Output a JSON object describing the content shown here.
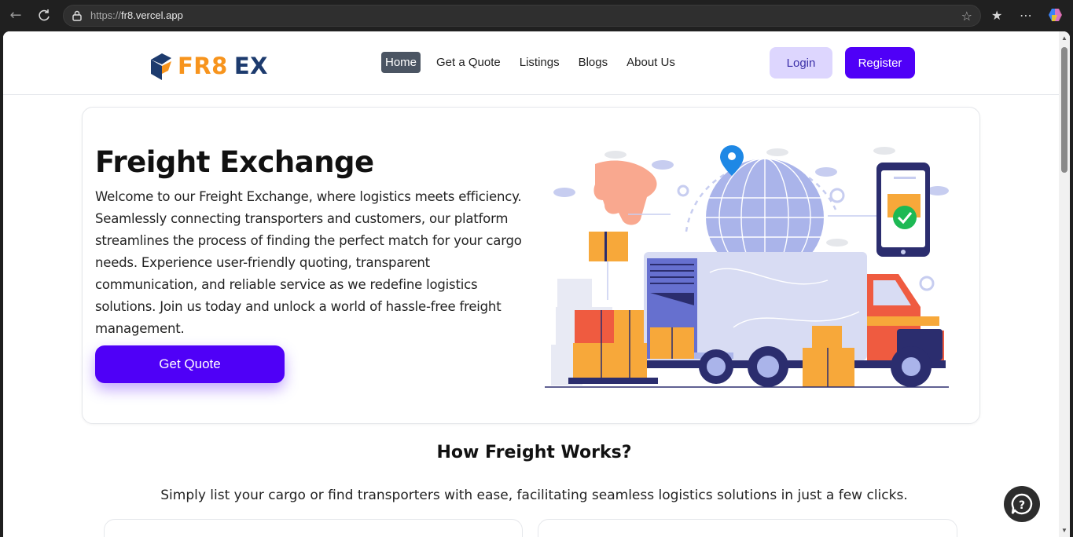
{
  "browser": {
    "url_protocol": "https://",
    "url_host": "fr8.vercel.app"
  },
  "header": {
    "logo_part1": "FR8",
    "logo_part2": "EX",
    "nav": [
      "Home",
      "Get a Quote",
      "Listings",
      "Blogs",
      "About Us"
    ],
    "active_nav": "Home",
    "login_label": "Login",
    "register_label": "Register"
  },
  "hero": {
    "title": "Freight Exchange",
    "body": "Welcome to our Freight Exchange, where logistics meets efficiency. Seamlessly connecting transporters and customers, our platform streamlines the process of finding the perfect match for your cargo needs. Experience user-friendly quoting, transparent communication, and reliable service as we redefine logistics solutions. Join us today and unlock a world of hassle-free freight management.",
    "cta_label": "Get Quote"
  },
  "how": {
    "title": "How Freight Works?",
    "subtitle": "Simply list your cargo or find transporters with ease, facilitating seamless logistics solutions in just a few clicks."
  },
  "colors": {
    "brand_orange": "#f7941d",
    "brand_navy": "#1d3b6e",
    "accent_purple": "#4f00f7",
    "login_bg": "#ddd6fe"
  },
  "icons": [
    "back-icon",
    "reload-icon",
    "lock-icon",
    "favorite-star-icon",
    "favorites-icon",
    "more-icon",
    "copilot-icon",
    "help-chat-icon"
  ]
}
